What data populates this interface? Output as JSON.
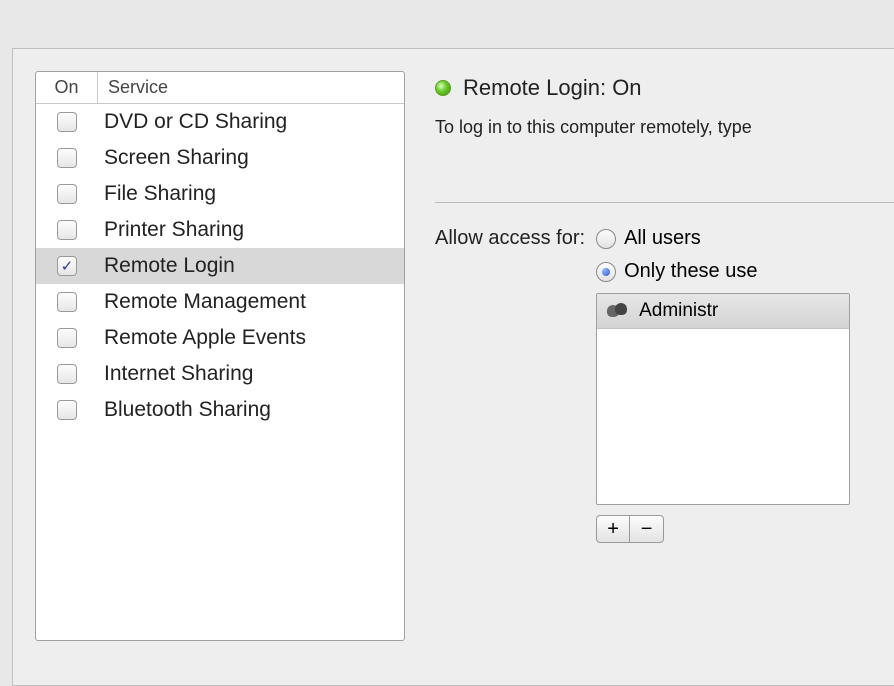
{
  "services": {
    "header_on": "On",
    "header_service": "Service",
    "items": [
      {
        "label": "DVD or CD Sharing",
        "checked": false,
        "selected": false
      },
      {
        "label": "Screen Sharing",
        "checked": false,
        "selected": false
      },
      {
        "label": "File Sharing",
        "checked": false,
        "selected": false
      },
      {
        "label": "Printer Sharing",
        "checked": false,
        "selected": false
      },
      {
        "label": "Remote Login",
        "checked": true,
        "selected": true
      },
      {
        "label": "Remote Management",
        "checked": false,
        "selected": false
      },
      {
        "label": "Remote Apple Events",
        "checked": false,
        "selected": false
      },
      {
        "label": "Internet Sharing",
        "checked": false,
        "selected": false
      },
      {
        "label": "Bluetooth Sharing",
        "checked": false,
        "selected": false
      }
    ]
  },
  "status": {
    "title": "Remote Login: On",
    "subtitle": "To log in to this computer remotely, type"
  },
  "access": {
    "label": "Allow access for:",
    "options": {
      "all": {
        "label": "All users",
        "selected": false
      },
      "these": {
        "label": "Only these use",
        "selected": true
      }
    }
  },
  "users": {
    "items": [
      {
        "label": "Administr"
      }
    ]
  },
  "buttons": {
    "add": "+",
    "remove": "−"
  }
}
